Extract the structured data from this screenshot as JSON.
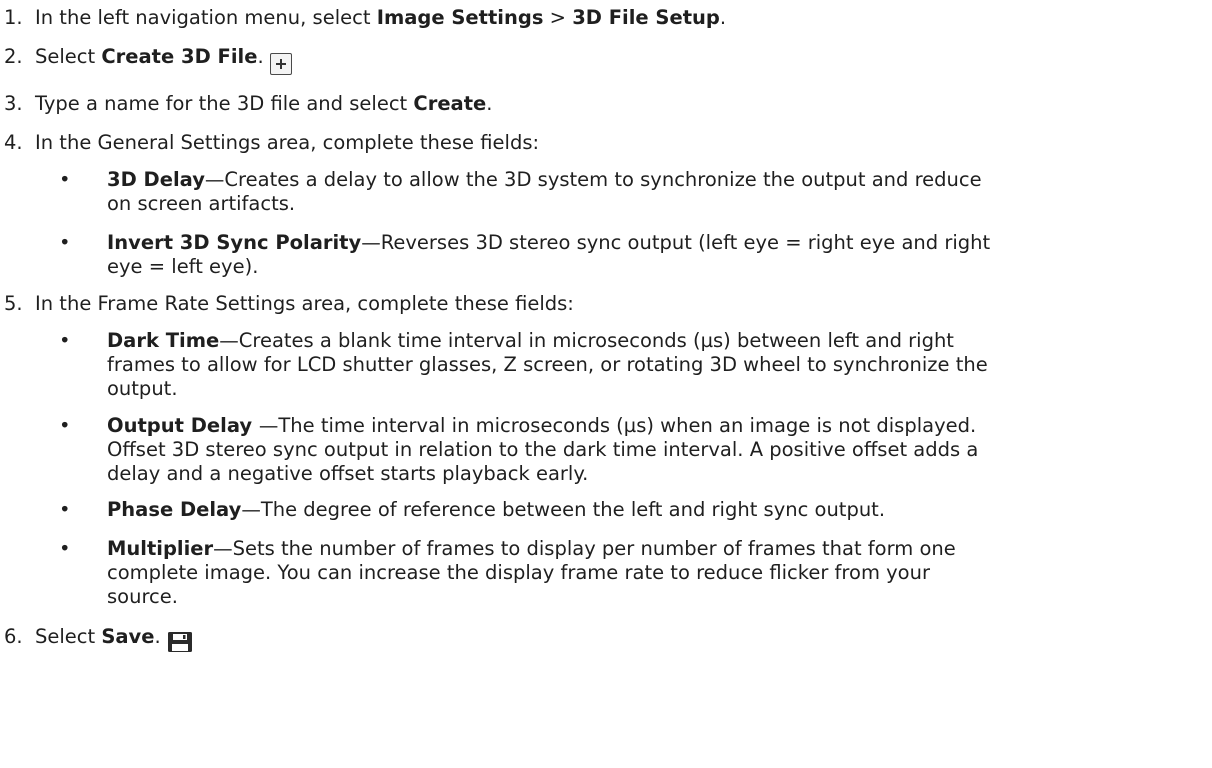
{
  "steps": [
    {
      "num": "1.",
      "pre": "In the left navigation menu, select ",
      "b1": "Image Settings",
      "mid": " > ",
      "b2": "3D File Setup",
      "post": "."
    },
    {
      "num": "2.",
      "pre": "Select ",
      "b1": "Create 3D File",
      "post": "."
    },
    {
      "num": "3.",
      "pre": "Type a name for the 3D file and select ",
      "b1": "Create",
      "post": "."
    },
    {
      "num": "4.",
      "text": "In the General Settings area, complete these fields:"
    },
    {
      "num": "5.",
      "text": "In the Frame Rate Settings area, complete these fields:"
    },
    {
      "num": "6.",
      "pre": "Select ",
      "b1": "Save",
      "post": "."
    }
  ],
  "general_bullets": [
    {
      "term": "3D Delay",
      "line1": "—Creates a delay to allow the 3D system to synchronize the output and reduce",
      "line2": "on screen artifacts."
    },
    {
      "term": "Invert 3D Sync Polarity",
      "line1": "—Reverses 3D stereo sync output (left eye = right eye and right",
      "line2": "eye = left eye)."
    }
  ],
  "frame_bullets": [
    {
      "term": "Dark Time",
      "line1": "—Creates a blank time interval in microseconds (µs) between left and right",
      "line2": "frames to allow for LCD shutter glasses, Z screen, or rotating 3D wheel to synchronize the",
      "line3": "output."
    },
    {
      "term": "Output Delay ",
      "line1": "—The time interval in microseconds (µs) when an image is not displayed.",
      "line2": "Offset 3D stereo sync output in relation to the dark time interval. A positive offset adds a",
      "line3": "delay and a negative offset starts playback early."
    },
    {
      "term": "Phase Delay",
      "line1": "—The degree of reference between the left and right sync output."
    },
    {
      "term": "Multiplier",
      "line1": "—Sets the number of frames to display per number of frames that form one",
      "line2": "complete image. You can increase the display frame rate to reduce flicker from your",
      "line3": "source."
    }
  ],
  "bullet_symbol": "•",
  "icons": {
    "create": "add-icon",
    "save": "save-icon"
  }
}
